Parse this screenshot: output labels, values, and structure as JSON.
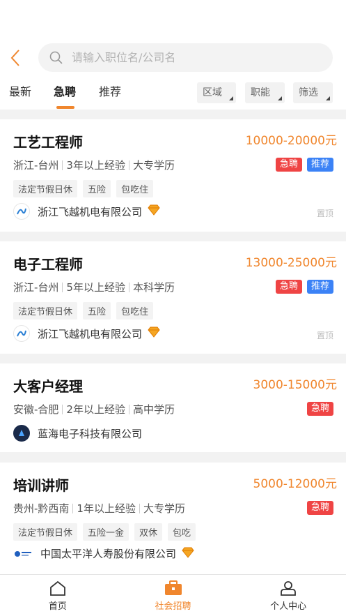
{
  "search": {
    "placeholder": "请输入职位名/公司名"
  },
  "tabs": [
    {
      "label": "最新"
    },
    {
      "label": "急聘"
    },
    {
      "label": "推荐"
    }
  ],
  "filters": [
    {
      "label": "区域"
    },
    {
      "label": "职能"
    },
    {
      "label": "筛选"
    }
  ],
  "jobs": [
    {
      "title": "工艺工程师",
      "salary": "10000-20000元",
      "location": "浙江-台州",
      "experience": "3年以上经验",
      "education": "大专学历",
      "badges": [
        "急聘",
        "推荐"
      ],
      "welfare": [
        "法定节假日休",
        "五险",
        "包吃住"
      ],
      "company": "浙江飞越机电有限公司",
      "pin": "置顶"
    },
    {
      "title": "电子工程师",
      "salary": "13000-25000元",
      "location": "浙江-台州",
      "experience": "5年以上经验",
      "education": "本科学历",
      "badges": [
        "急聘",
        "推荐"
      ],
      "welfare": [
        "法定节假日休",
        "五险",
        "包吃住"
      ],
      "company": "浙江飞越机电有限公司",
      "pin": "置顶"
    },
    {
      "title": "大客户经理",
      "salary": "3000-15000元",
      "location": "安徽-合肥",
      "experience": "2年以上经验",
      "education": "高中学历",
      "badges": [
        "急聘"
      ],
      "company": "蓝海电子科技有限公司"
    },
    {
      "title": "培训讲师",
      "salary": "5000-12000元",
      "location": "贵州-黔西南",
      "experience": "1年以上经验",
      "education": "大专学历",
      "badges": [
        "急聘"
      ],
      "welfare": [
        "法定节假日休",
        "五险一金",
        "双休",
        "包吃"
      ],
      "company": "中国太平洋人寿股份有限公司"
    }
  ],
  "bottom_nav": [
    {
      "label": "首页",
      "icon": "home-icon"
    },
    {
      "label": "社会招聘",
      "icon": "briefcase-icon"
    },
    {
      "label": "个人中心",
      "icon": "user-icon"
    }
  ],
  "colors": {
    "accent": "#f0862d",
    "urgent": "#ef4444",
    "recommend": "#3b82f6"
  }
}
